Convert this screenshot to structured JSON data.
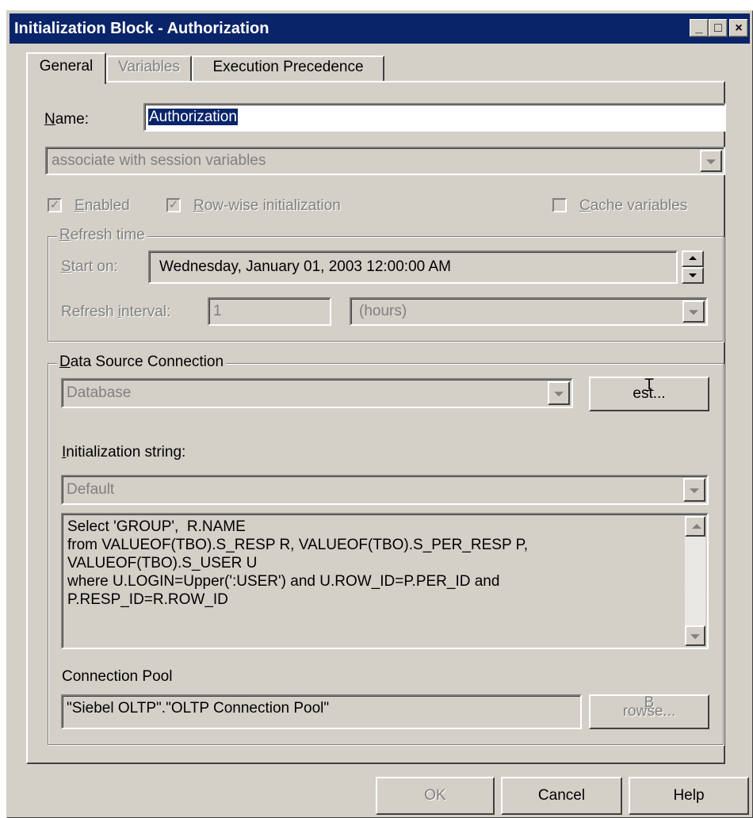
{
  "window": {
    "title": "Initialization Block - Authorization",
    "minimize_glyph": "_",
    "maximize_glyph": "□",
    "close_glyph": "×"
  },
  "tabs": [
    {
      "label": "General",
      "active": true
    },
    {
      "label": "Variables",
      "disabled": true
    },
    {
      "label": "Execution Precedence"
    }
  ],
  "general": {
    "name_label_accel": "N",
    "name_label_rest": "ame:",
    "name_value": "Authorization",
    "association": "associate with session variables",
    "enabled_label_accel": "E",
    "enabled_label_rest": "nabled",
    "enabled_checked": true,
    "rowwise_label_accel": "R",
    "rowwise_label_rest": "ow-wise initialization",
    "rowwise_checked": true,
    "cache_label_accel": "C",
    "cache_label_rest": "ache variables",
    "cache_checked": false,
    "check_glyph": "✓"
  },
  "refresh": {
    "legend_accel": "R",
    "legend_rest": "efresh time",
    "start_label_accel": "S",
    "start_label_rest": "tart on:",
    "start_value": "Wednesday,   January   01, 2003 12:00:00 AM",
    "interval_label_pre": "Refresh ",
    "interval_label_accel": "i",
    "interval_label_rest": "nterval:",
    "interval_value": "1",
    "interval_unit": "(hours)"
  },
  "datasource": {
    "legend_accel": "D",
    "legend_rest": "ata Source Connection",
    "type_value": "Database",
    "test_button_accel": "T",
    "test_button_rest": "est...",
    "init_label_accel": "I",
    "init_label_rest": "nitialization string:",
    "init_selection": "Default",
    "sql": "Select 'GROUP',  R.NAME\nfrom VALUEOF(TBO).S_RESP R, VALUEOF(TBO).S_PER_RESP P,\nVALUEOF(TBO).S_USER U\nwhere U.LOGIN=Upper(':USER') and U.ROW_ID=P.PER_ID and\nP.RESP_ID=R.ROW_ID",
    "pool_label": "Connection Pool",
    "pool_value": "\"Siebel OLTP\".\"OLTP Connection Pool\"",
    "browse_button_accel": "B",
    "browse_button_rest": "rowse..."
  },
  "footer": {
    "ok_label": "OK",
    "cancel_label": "Cancel",
    "help_label": "Help"
  },
  "colors": {
    "titlebar": "#0a246a",
    "face": "#d4d0c8",
    "disabled_text": "#808080"
  }
}
